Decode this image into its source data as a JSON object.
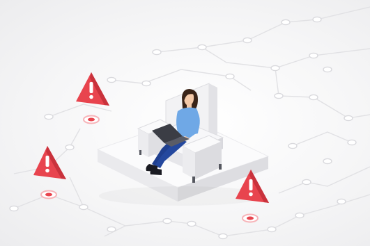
{
  "illustration": {
    "subject": "person-working-on-laptop-on-sofa",
    "icons": [
      "warning-icon",
      "warning-icon",
      "warning-icon",
      "laptop-icon"
    ],
    "colors": {
      "background": "#f4f4f5",
      "circuit_line": "#e1e1e4",
      "node_fill": "#ffffff",
      "node_stroke": "#d9d9dd",
      "platform_top": "#fbfbfc",
      "platform_side": "#e3e3e6",
      "sofa": "#ececee",
      "shirt": "#6fa8e6",
      "pants": "#1f3f8f",
      "hair": "#3a2418",
      "skin": "#f4c9a8",
      "laptop": "#3b3d45",
      "warning_red": "#e8444e",
      "warning_dark": "#c9323c",
      "pulse_ring": "#f7b3b8"
    }
  }
}
